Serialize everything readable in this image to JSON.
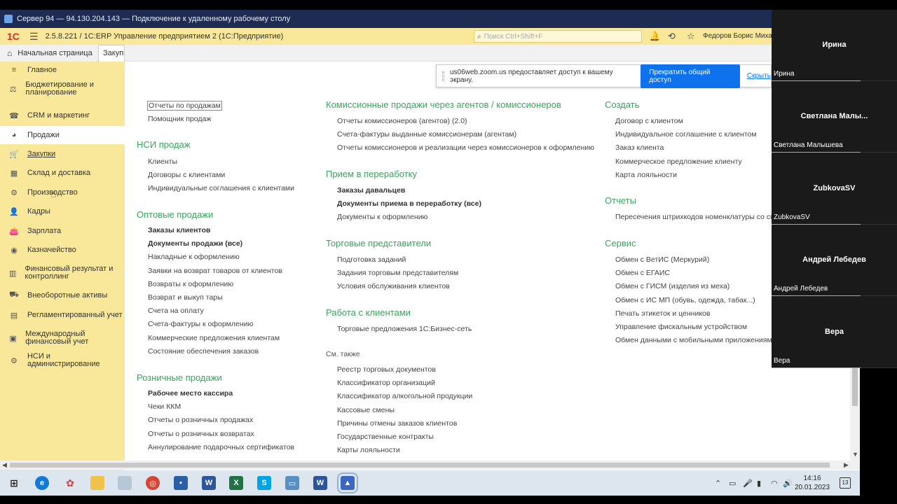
{
  "rdp": {
    "title": "Сервер 94 — 94.130.204.143 — Подключение к удаленному рабочему столу"
  },
  "app": {
    "logo": "1С",
    "title": "2.5.8.221 / 1С:ERP Управление предприятием 2 (1С:Предприятие)",
    "search_placeholder": "Поиск Ctrl+Shift+F",
    "user": "Федоров Борис Михайл"
  },
  "tabs": {
    "home": "Начальная страница",
    "second": "Закупк"
  },
  "sidebar": {
    "items": [
      {
        "label": "Главное",
        "icon": "≡"
      },
      {
        "label": "Бюджетирование и планирование",
        "icon": "⚖"
      },
      {
        "label": "CRM и маркетинг",
        "icon": "☎"
      },
      {
        "label": "Продажи",
        "icon": "◕"
      },
      {
        "label": "Закупки",
        "icon": "🛒"
      },
      {
        "label": "Склад и доставка",
        "icon": "▦"
      },
      {
        "label": "Производство",
        "icon": "⚙"
      },
      {
        "label": "Кадры",
        "icon": "👤"
      },
      {
        "label": "Зарплата",
        "icon": "👛"
      },
      {
        "label": "Казначейство",
        "icon": "◉"
      },
      {
        "label": "Финансовый результат и контроллинг",
        "icon": "▥"
      },
      {
        "label": "Внеоборотные активы",
        "icon": "⛟"
      },
      {
        "label": "Регламентированный учет",
        "icon": "▤"
      },
      {
        "label": "Международный финансовый учет",
        "icon": "▣"
      },
      {
        "label": "НСИ и администрирование",
        "icon": "⚙"
      }
    ]
  },
  "content": {
    "col1": {
      "top_links": [
        "Отчеты по продажам",
        "Помощник продаж"
      ],
      "nsi_title": "НСИ продаж",
      "nsi_links": [
        "Клиенты",
        "Договоры с клиентами",
        "Индивидуальные соглашения с клиентами"
      ],
      "opt_title": "Оптовые продажи",
      "opt_links": [
        "Заказы клиентов",
        "Документы продажи (все)",
        "Накладные к оформлению",
        "Заявки на возврат товаров от клиентов",
        "Возвраты к оформлению",
        "Возврат и выкуп тары",
        "Счета на оплату",
        "Счета-фактуры к оформлению",
        "Коммерческие предложения клиентам",
        "Состояние обеспечения заказов"
      ],
      "retail_title": "Розничные продажи",
      "retail_links": [
        "Рабочее место кассира",
        "Чеки ККМ",
        "Отчеты о розничных продажах",
        "Отчеты о розничных возвратах",
        "Аннулирование подарочных сертификатов"
      ]
    },
    "col2": {
      "comm_title": "Комиссионные продажи через агентов / комиссионеров",
      "comm_links": [
        "Отчеты комиссионеров (агентов) (2.0)",
        "Счета-фактуры выданные комиссионерам (агентам)",
        "Отчеты комиссионеров и реализации через комиссионеров к оформлению"
      ],
      "recv_title": "Прием в переработку",
      "recv_links": [
        "Заказы давальцев",
        "Документы приема в переработку (все)",
        "Документы к оформлению"
      ],
      "reps_title": "Торговые представители",
      "reps_links": [
        "Подготовка заданий",
        "Задания торговым представителям",
        "Условия обслуживания клиентов"
      ],
      "clients_title": "Работа с клиентами",
      "clients_links": [
        "Торговые предложения 1С:Бизнес-сеть"
      ],
      "see_also": "См. также",
      "see_links": [
        "Реестр торговых документов",
        "Классификатор организаций",
        "Классификатор алкогольной продукции",
        "Кассовые смены",
        "Причины отмены заказов клиентов",
        "Государственные контракты",
        "Карты лояльности"
      ]
    },
    "col3": {
      "create_title": "Создать",
      "create_links": [
        "Договор с клиентом",
        "Индивидуальное соглашение с клиентом",
        "Заказ клиента",
        "Коммерческое предложение клиенту",
        "Карта лояльности"
      ],
      "reports_title": "Отчеты",
      "reports_links": [
        "Пересечения штрихкодов номенклатуры со спе"
      ],
      "service_title": "Сервис",
      "service_links": [
        "Обмен с ВетИС (Меркурий)",
        "Обмен с ЕГАИС",
        "Обмен с ГИСМ (изделия из меха)",
        "Обмен с ИС МП (обувь, одежда, табак...)",
        "Печать этикеток и ценников",
        "Управление фискальным устройством",
        "Обмен данными с мобильными приложениями"
      ]
    }
  },
  "zoom": {
    "message": "us06web.zoom.us предоставляет доступ к вашему экрану.",
    "stop_label": "Прекратить общий доступ",
    "hide_label": "Скрыть"
  },
  "participants": [
    {
      "name": "Ирина",
      "label": "Ирина"
    },
    {
      "name": "Светлана Малы...",
      "label": "Светлана Малышева"
    },
    {
      "name": "ZubkovaSV",
      "label": "ZubkovaSV"
    },
    {
      "name": "Андрей Лебедев",
      "label": "Андрей Лебедев"
    },
    {
      "name": "Вера",
      "label": "Вера"
    }
  ],
  "taskbar": {
    "time": "14:16",
    "date": "20.01.2023",
    "notifications": "13"
  }
}
